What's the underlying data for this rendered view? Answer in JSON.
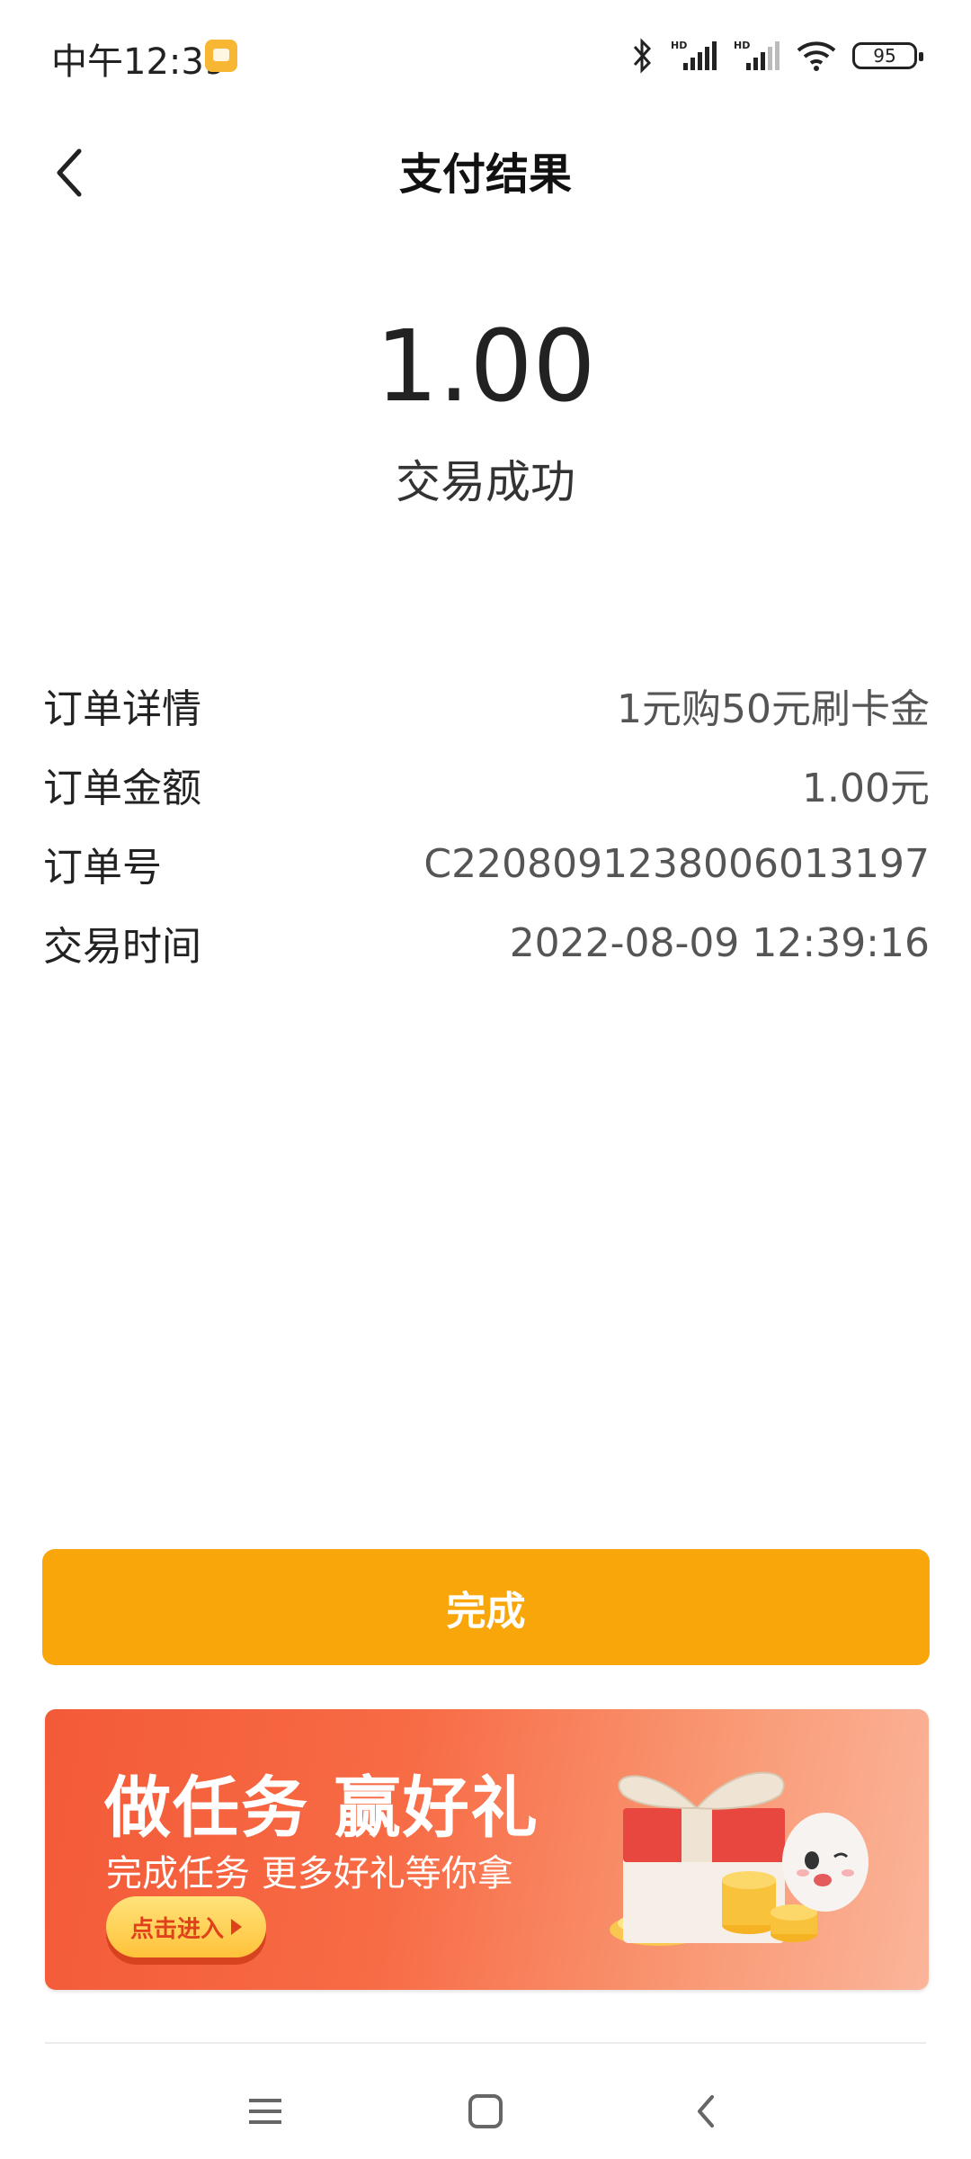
{
  "status_bar": {
    "time": "中午12:39",
    "battery": "95",
    "hd_label": "HD"
  },
  "header": {
    "title": "支付结果",
    "back_icon": "chevron-left-icon"
  },
  "result": {
    "amount": "1.00",
    "status": "交易成功"
  },
  "details": [
    {
      "label": "订单详情",
      "value": "1元购50元刷卡金"
    },
    {
      "label": "订单金额",
      "value": "1.00元"
    },
    {
      "label": "订单号",
      "value": "C2208091238006013197"
    },
    {
      "label": "交易时间",
      "value": "2022-08-09 12:39:16"
    }
  ],
  "actions": {
    "done_label": "完成",
    "done_color": "#f8a60a"
  },
  "banner": {
    "title": "做任务 赢好礼",
    "subtitle": "完成任务 更多好礼等你拿",
    "button_label": "点击进入",
    "accent_color": "#f35a38"
  },
  "system_nav": {
    "menu_icon": "menu-icon",
    "home_icon": "home-square-icon",
    "back_icon": "back-chevron-icon"
  }
}
